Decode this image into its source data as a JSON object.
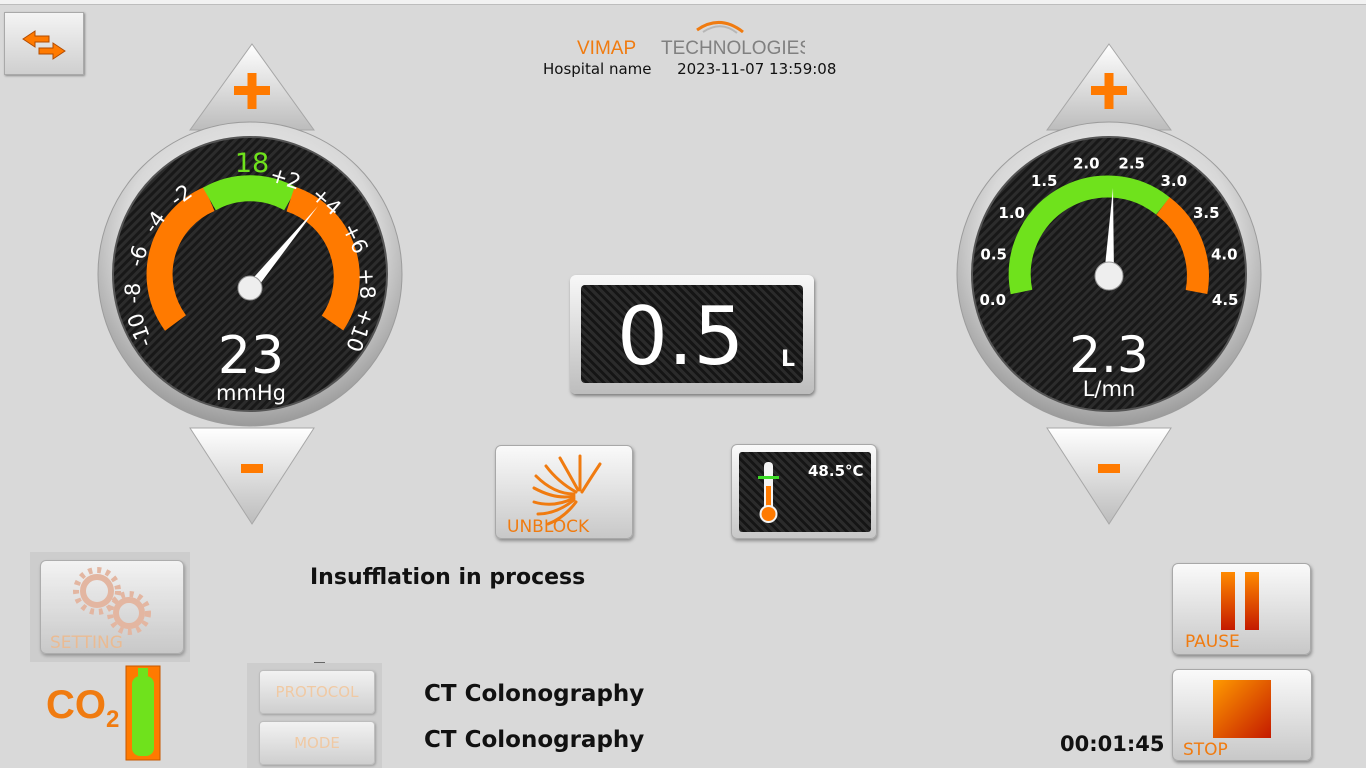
{
  "header": {
    "logo_text_1": "VIMAP",
    "logo_text_2": "TECHNOLOGIES",
    "hospital_name": "Hospital name",
    "datetime": "2023-11-07 13:59:08"
  },
  "pressure_gauge": {
    "value": "23",
    "unit": "mmHg",
    "setpoint": "18",
    "scale_labels": [
      "-10",
      "-8",
      "-6",
      "-4",
      "-2",
      "+2",
      "+4",
      "+6",
      "+8",
      "+10"
    ],
    "plus_icon": "plus-icon",
    "minus_icon": "minus-icon"
  },
  "flow_gauge": {
    "value": "2.3",
    "unit": "L/mn",
    "scale_labels": [
      "0.0",
      "0.5",
      "1.0",
      "1.5",
      "2.0",
      "2.5",
      "3.0",
      "3.5",
      "4.0",
      "4.5"
    ],
    "plus_icon": "plus-icon",
    "minus_icon": "minus-icon"
  },
  "volume": {
    "value": "0.5",
    "unit": "L"
  },
  "unblock_button": {
    "label": "UNBLOCK"
  },
  "temperature": {
    "value": "48.5°C"
  },
  "status_text": "Insufflation in process",
  "cursor_mark": "_",
  "setting_button": {
    "label": "SETTING"
  },
  "co2": {
    "label_main": "CO",
    "label_sub": "2"
  },
  "protocol_button": {
    "label": "PROTOCOL"
  },
  "mode_button": {
    "label": "MODE"
  },
  "protocol_value": "CT Colonography",
  "mode_value": "CT Colonography",
  "pause_button": {
    "label": "PAUSE"
  },
  "stop_button": {
    "label": "STOP"
  },
  "timer": "00:01:45",
  "colors": {
    "accent": "#f07b10",
    "green": "#6fe21c",
    "orange": "#ff7a00"
  }
}
